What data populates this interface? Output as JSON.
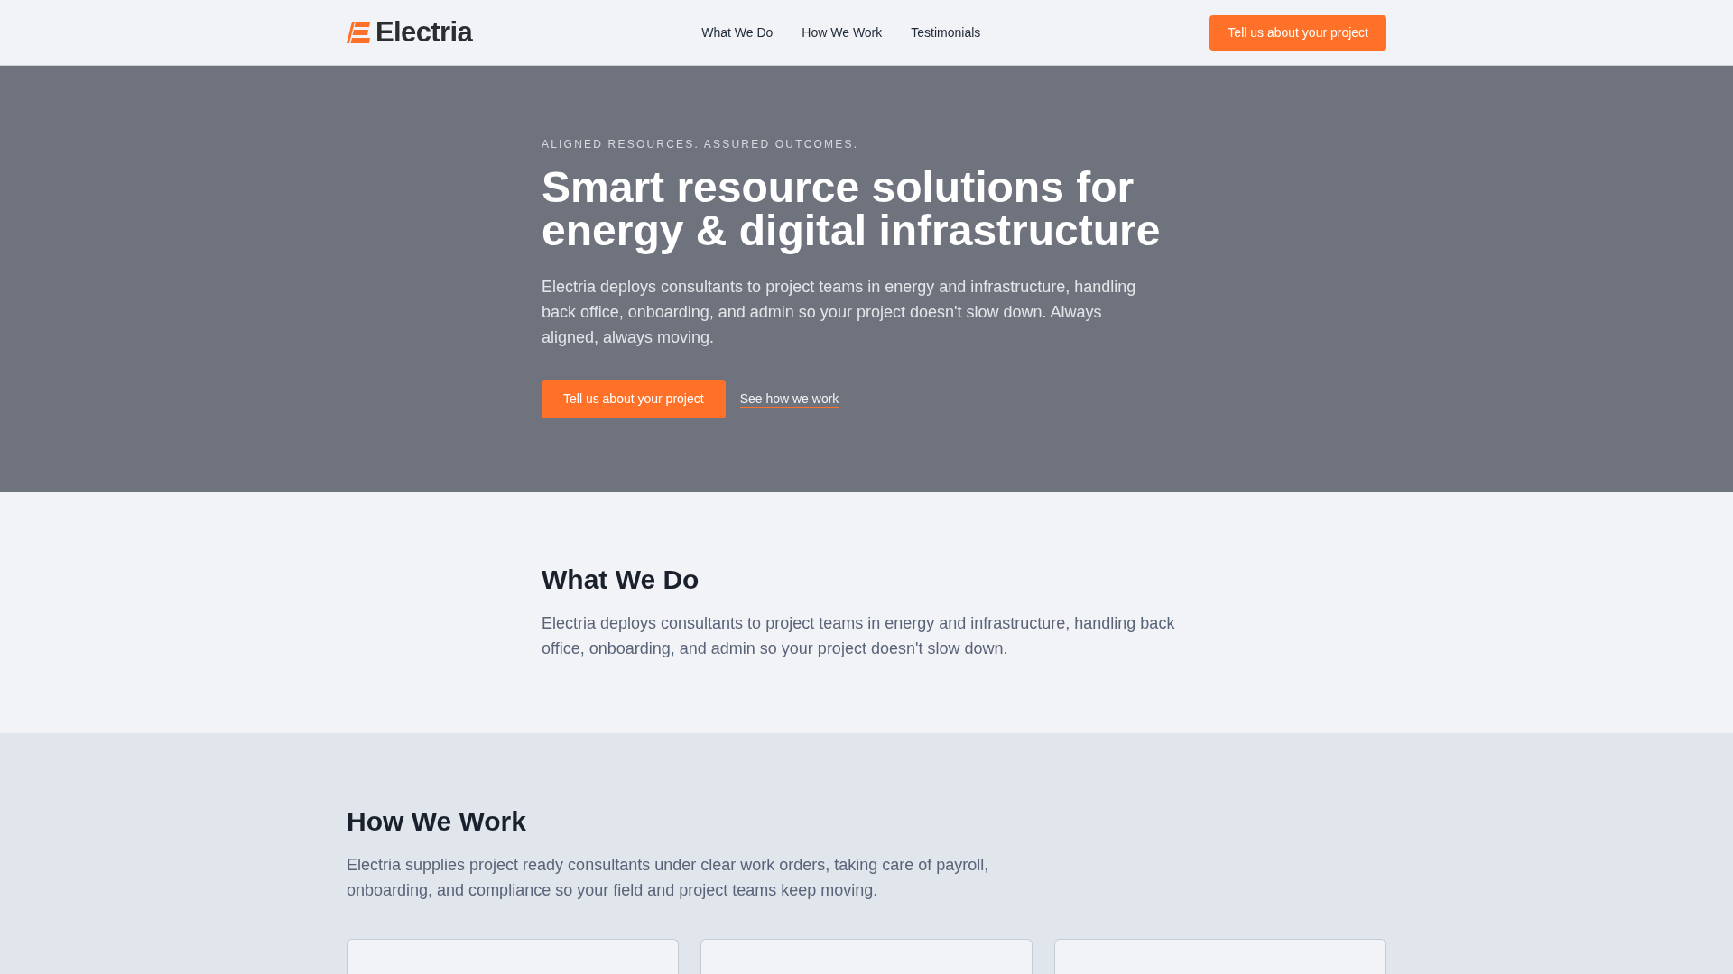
{
  "header": {
    "brand": "Electria",
    "nav": [
      {
        "label": "What We Do"
      },
      {
        "label": "How We Work"
      },
      {
        "label": "Testimonials"
      }
    ],
    "cta": "Tell us about your project"
  },
  "hero": {
    "eyebrow": "ALIGNED RESOURCES. ASSURED OUTCOMES.",
    "title": "Smart resource solutions for energy & digital infrastructure",
    "text": "Electria deploys consultants to project teams in energy and infrastructure, handling back office, onboarding, and admin so your project doesn't slow down. Always aligned, always moving.",
    "primary_button": "Tell us about your project",
    "secondary_link": "See how we work"
  },
  "what_we_do": {
    "heading": "What We Do",
    "text": "Electria deploys consultants to project teams in energy and infrastructure, handling back office, onboarding, and admin so your project doesn't slow down."
  },
  "how_we_work": {
    "heading": "How We Work",
    "text": "Electria supplies project ready consultants under clear work orders, taking care of payroll, onboarding, and compliance so your field and project teams keep moving."
  }
}
